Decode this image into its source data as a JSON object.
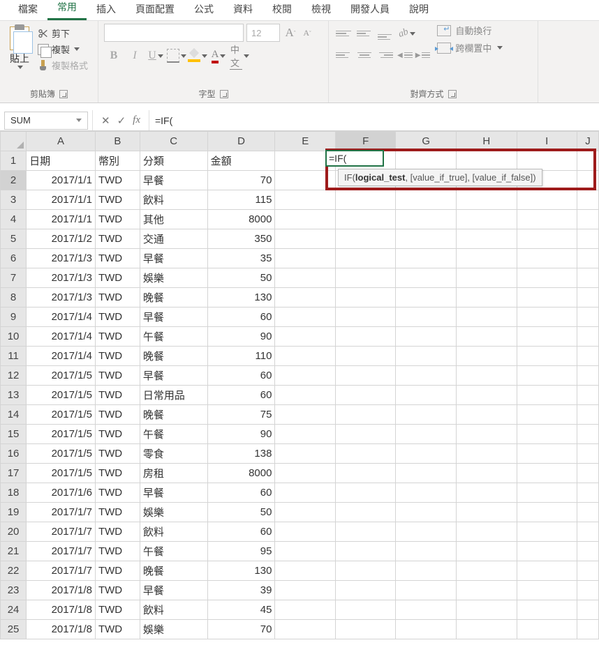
{
  "tabs": [
    "檔案",
    "常用",
    "插入",
    "頁面配置",
    "公式",
    "資料",
    "校閱",
    "檢視",
    "開發人員",
    "說明"
  ],
  "active_tab_index": 1,
  "clipboard": {
    "paste": "貼上",
    "cut": "剪下",
    "copy": "複製",
    "format_painter": "複製格式",
    "group_label": "剪貼簿"
  },
  "font": {
    "name_placeholder": "",
    "size": "12",
    "grow": "A",
    "shrink": "A",
    "bold": "B",
    "italic": "I",
    "underline": "U",
    "fontcolor_letter": "A",
    "phonetic": "中文",
    "group_label": "字型"
  },
  "alignment": {
    "orientation_glyph": "ab",
    "wrap_text": "自動換行",
    "merge_center": "跨欄置中",
    "group_label": "對齊方式"
  },
  "name_box": "SUM",
  "formula_bar": "=IF(",
  "fx_label": "fx",
  "cancel_glyph": "✕",
  "enter_glyph": "✓",
  "columns": [
    "A",
    "B",
    "C",
    "D",
    "E",
    "F",
    "G",
    "H",
    "I",
    "J"
  ],
  "headers": {
    "A": "日期",
    "B": "幣別",
    "C": "分類",
    "D": "金額"
  },
  "rows": [
    {
      "n": 1,
      "A": "日期",
      "B": "幣別",
      "C": "分類",
      "D": "金額",
      "header": true
    },
    {
      "n": 2,
      "A": "2017/1/1",
      "B": "TWD",
      "C": "早餐",
      "D": "70"
    },
    {
      "n": 3,
      "A": "2017/1/1",
      "B": "TWD",
      "C": "飲料",
      "D": "115"
    },
    {
      "n": 4,
      "A": "2017/1/1",
      "B": "TWD",
      "C": "其他",
      "D": "8000"
    },
    {
      "n": 5,
      "A": "2017/1/2",
      "B": "TWD",
      "C": "交通",
      "D": "350"
    },
    {
      "n": 6,
      "A": "2017/1/3",
      "B": "TWD",
      "C": "早餐",
      "D": "35"
    },
    {
      "n": 7,
      "A": "2017/1/3",
      "B": "TWD",
      "C": "娛樂",
      "D": "50"
    },
    {
      "n": 8,
      "A": "2017/1/3",
      "B": "TWD",
      "C": "晚餐",
      "D": "130"
    },
    {
      "n": 9,
      "A": "2017/1/4",
      "B": "TWD",
      "C": "早餐",
      "D": "60"
    },
    {
      "n": 10,
      "A": "2017/1/4",
      "B": "TWD",
      "C": "午餐",
      "D": "90"
    },
    {
      "n": 11,
      "A": "2017/1/4",
      "B": "TWD",
      "C": "晚餐",
      "D": "110"
    },
    {
      "n": 12,
      "A": "2017/1/5",
      "B": "TWD",
      "C": "早餐",
      "D": "60"
    },
    {
      "n": 13,
      "A": "2017/1/5",
      "B": "TWD",
      "C": "日常用品",
      "D": "60"
    },
    {
      "n": 14,
      "A": "2017/1/5",
      "B": "TWD",
      "C": "晚餐",
      "D": "75"
    },
    {
      "n": 15,
      "A": "2017/1/5",
      "B": "TWD",
      "C": "午餐",
      "D": "90"
    },
    {
      "n": 16,
      "A": "2017/1/5",
      "B": "TWD",
      "C": "零食",
      "D": "138"
    },
    {
      "n": 17,
      "A": "2017/1/5",
      "B": "TWD",
      "C": "房租",
      "D": "8000"
    },
    {
      "n": 18,
      "A": "2017/1/6",
      "B": "TWD",
      "C": "早餐",
      "D": "60"
    },
    {
      "n": 19,
      "A": "2017/1/7",
      "B": "TWD",
      "C": "娛樂",
      "D": "50"
    },
    {
      "n": 20,
      "A": "2017/1/7",
      "B": "TWD",
      "C": "飲料",
      "D": "60"
    },
    {
      "n": 21,
      "A": "2017/1/7",
      "B": "TWD",
      "C": "午餐",
      "D": "95"
    },
    {
      "n": 22,
      "A": "2017/1/7",
      "B": "TWD",
      "C": "晚餐",
      "D": "130"
    },
    {
      "n": 23,
      "A": "2017/1/8",
      "B": "TWD",
      "C": "早餐",
      "D": "39"
    },
    {
      "n": 24,
      "A": "2017/1/8",
      "B": "TWD",
      "C": "飲料",
      "D": "45"
    },
    {
      "n": 25,
      "A": "2017/1/8",
      "B": "TWD",
      "C": "娛樂",
      "D": "70"
    }
  ],
  "active_cell": {
    "ref": "F2",
    "value": "=IF("
  },
  "tooltip": {
    "fn": "IF",
    "bold_arg": "logical_test",
    "rest": ", [value_if_true], [value_if_false])"
  }
}
